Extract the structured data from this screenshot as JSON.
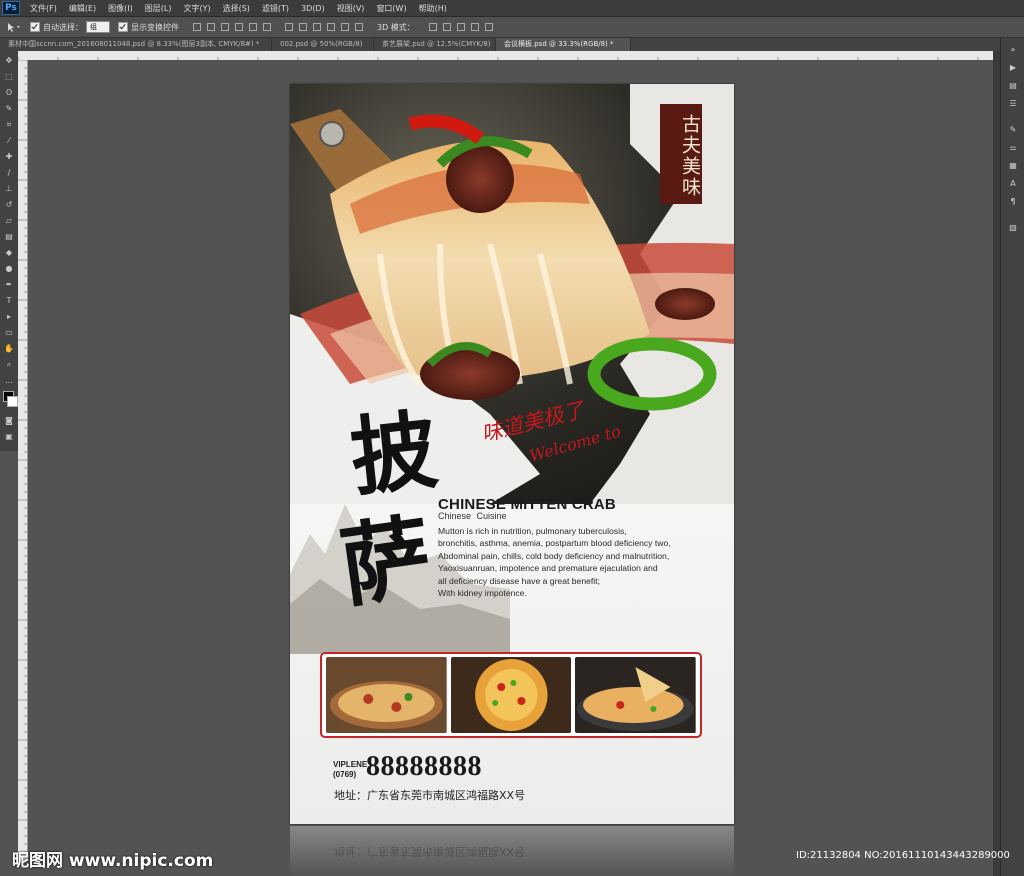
{
  "app": {
    "logo": "Ps"
  },
  "menu": [
    "文件(F)",
    "编辑(E)",
    "图像(I)",
    "图层(L)",
    "文字(Y)",
    "选择(S)",
    "滤镜(T)",
    "3D(D)",
    "视图(V)",
    "窗口(W)",
    "帮助(H)"
  ],
  "options": {
    "auto_select_label": "自动选择：",
    "auto_select_value": "组",
    "show_transform_label": "显示变换控件",
    "mode_3d_label": "3D 模式："
  },
  "tabs": [
    "素材中国sccnn.com_201608011048.psd @ 8.33%(图层3副本, CMYK/8#) *",
    "002.psd @ 50%(RGB/8)",
    "茶艺展架.psd @ 12.5%(CMYK/8)",
    "会议横板.psd @ 33.3%(RGB/8) *"
  ],
  "poster": {
    "seal_text": "古夫美味",
    "char1": "披",
    "char2": "萨",
    "script_cn": "味道美极了",
    "script_en": "Welcome to",
    "headline": "CHINESE MITTEN CRAB",
    "subhead": "Chinese  Cuisine",
    "body": [
      "Mutton is rich in nutrition, pulmonary tuberculosis,",
      "bronchitis, asthma, anemia, postpartum blood deficiency two,",
      "Abdominal pain, chills, cold body deficiency and malnutrition,",
      "Yaoxisuanruan, impotence and premature ejaculation and",
      "all deficiency disease have a great benefit;",
      "With kidney impotence."
    ],
    "viplene": "VIPLENE",
    "area_code": "(0769)",
    "phone": "88888888",
    "address": "地址：广东省东莞市南城区鸿福路XX号"
  },
  "watermark": {
    "left": "昵图网 www.nipic.com",
    "right": "ID:21132804 NO:20161110143443289000"
  },
  "colors": {
    "accent_red": "#c4181e",
    "seal": "#5a1a14",
    "ps_bg": "#535353"
  }
}
